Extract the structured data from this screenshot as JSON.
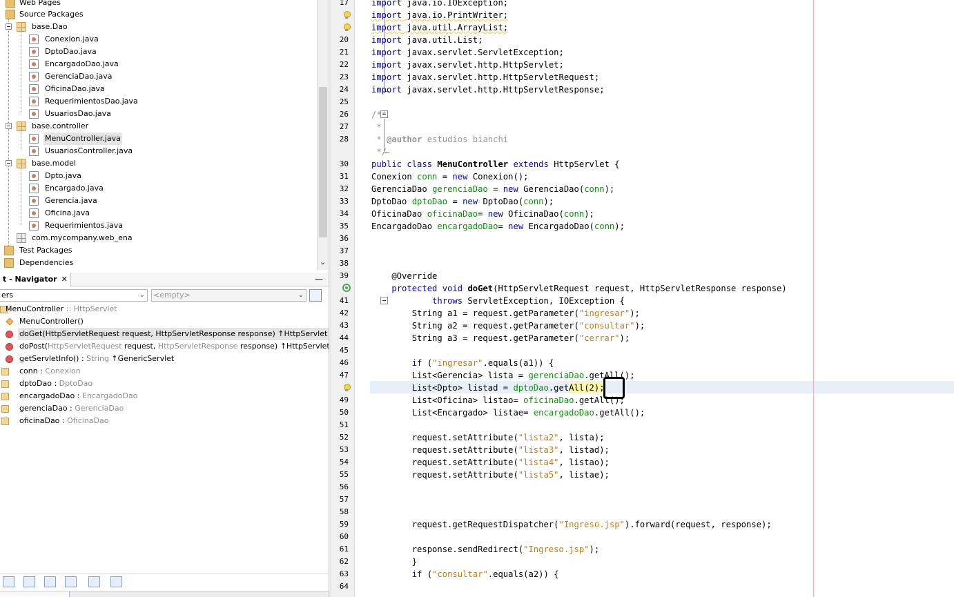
{
  "projects": {
    "nodes": [
      {
        "label": "Web Pages"
      },
      {
        "label": "Source Packages"
      },
      {
        "label": "base.Dao"
      },
      {
        "label": "Conexion.java"
      },
      {
        "label": "DptoDao.java"
      },
      {
        "label": "EncargadoDao.java"
      },
      {
        "label": "GerenciaDao.java"
      },
      {
        "label": "OficinaDao.java"
      },
      {
        "label": "RequerimientosDao.java"
      },
      {
        "label": "UsuariosDao.java"
      },
      {
        "label": "base.controller"
      },
      {
        "label": "MenuController.java"
      },
      {
        "label": "UsuariosController.java"
      },
      {
        "label": "base.model"
      },
      {
        "label": "Dpto.java"
      },
      {
        "label": "Encargado.java"
      },
      {
        "label": "Gerencia.java"
      },
      {
        "label": "Oficina.java"
      },
      {
        "label": "Requerimientos.java"
      },
      {
        "label": "com.mycompany.web_ena"
      },
      {
        "label": "Test Packages"
      },
      {
        "label": "Dependencies"
      }
    ],
    "selected": "MenuController.java",
    "scroll_arrow": "⌄"
  },
  "navigator": {
    "tab_label": "t - Navigator",
    "close_glyph": "✕",
    "minimize_glyph": "—",
    "filter_value": "ers",
    "combo2_value": "<empty>",
    "items": [
      {
        "name": "MenuController",
        "suffix": " :: HttpServlet",
        "icon": "class-icon"
      },
      {
        "name": "MenuController()",
        "suffix": "",
        "icon": "constructor-icon"
      },
      {
        "name": "doGet(HttpServletRequest request, HttpServletResponse response) ↑HttpServlet",
        "suffix": "",
        "icon": "method-icon"
      },
      {
        "name": "doPost(",
        "mid1": "HttpServletRequest",
        "mid2": " request, ",
        "mid3": "HttpServletResponse",
        "mid4": " response) ↑HttpServlet",
        "icon": "method-icon"
      },
      {
        "name": "getServletInfo() : ",
        "suffix": "String",
        "tail": " ↑GenericServlet",
        "icon": "method-icon"
      },
      {
        "name": "conn : ",
        "suffix": "Conexion",
        "icon": "field-icon"
      },
      {
        "name": "dptoDao : ",
        "suffix": "DptoDao",
        "icon": "field-icon"
      },
      {
        "name": "encargadoDao : ",
        "suffix": "EncargadoDao",
        "icon": "field-icon"
      },
      {
        "name": "gerenciaDao : ",
        "suffix": "GerenciaDao",
        "icon": "field-icon"
      },
      {
        "name": "oficinaDao : ",
        "suffix": "OficinaDao",
        "icon": "field-icon"
      }
    ]
  },
  "editor": {
    "line_numbers": [
      "17",
      "",
      "",
      "20",
      "21",
      "22",
      "23",
      "24",
      "25",
      "26",
      "27",
      "28",
      "",
      "30",
      "31",
      "32",
      "33",
      "34",
      "35",
      "36",
      "37",
      "38",
      "39",
      "",
      "41",
      "42",
      "43",
      "44",
      "45",
      "46",
      "47",
      "",
      "49",
      "50",
      "51",
      "52",
      "53",
      "54",
      "55",
      "56",
      "57",
      "58",
      "59",
      "60",
      "61",
      "62",
      "63",
      "64"
    ]
  }
}
